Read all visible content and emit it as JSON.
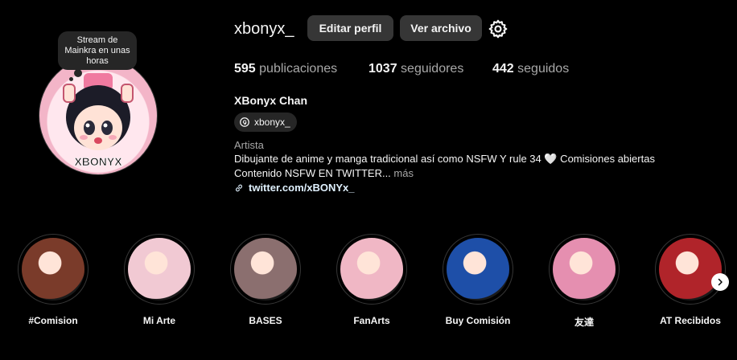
{
  "profile": {
    "username": "xbonyx_",
    "full_name": "XBonyx Chan",
    "threads_handle": "xbonyx_",
    "category": "Artista",
    "bio_line1": "Dibujante de anime y manga tradicional así como NSFW Y rule 34 🤍 Comisiones abiertas",
    "bio_line2": "Contenido NSFW EN TWITTER...",
    "more_label": "más",
    "link": "twitter.com/xBONYx_",
    "avatar_text": "XBONYX"
  },
  "note": {
    "text": "Stream de Mainkra en unas horas"
  },
  "actions": {
    "edit_label": "Editar perfil",
    "archive_label": "Ver archivo"
  },
  "stats": {
    "posts_count": "595",
    "posts_label": "publicaciones",
    "followers_count": "1037",
    "followers_label": "seguidores",
    "following_count": "442",
    "following_label": "seguidos"
  },
  "highlights": [
    {
      "label": "#Comision",
      "color": "#7a3b2a"
    },
    {
      "label": "Mi Arte",
      "color": "#f1c9d3"
    },
    {
      "label": "BASES",
      "color": "#8b6f6f"
    },
    {
      "label": "FanArts",
      "color": "#f0b7c5"
    },
    {
      "label": "Buy Comisión",
      "color": "#1e4fa8"
    },
    {
      "label": "友達",
      "color": "#e58fb0"
    },
    {
      "label": "AT Recibidos",
      "color": "#b0242a"
    }
  ],
  "icons": {
    "settings": "gear-icon",
    "threads": "threads-icon",
    "link": "link-icon",
    "next": "chevron-right-icon"
  }
}
